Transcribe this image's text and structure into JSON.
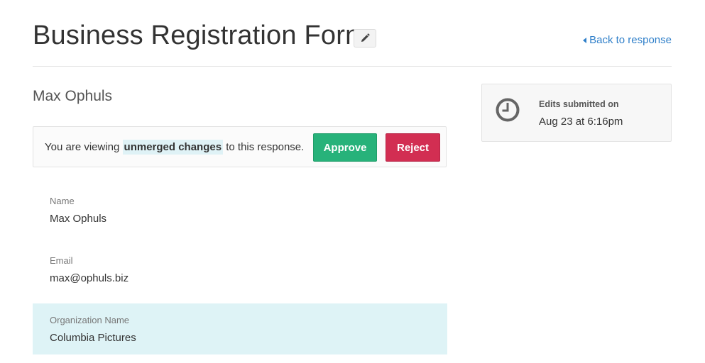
{
  "header": {
    "title": "Business Registration Form",
    "edit_icon": "pencil-icon",
    "back_link": "Back to response",
    "back_icon": "caret-left-icon"
  },
  "respondent": {
    "name": "Max Ophuls"
  },
  "notice": {
    "text_before": "You are viewing ",
    "highlight": "unmerged changes",
    "text_after": " to this response.",
    "approve_label": "Approve",
    "reject_label": "Reject"
  },
  "fields": [
    {
      "label": "Name",
      "value": "Max Ophuls"
    },
    {
      "label": "Email",
      "value": "max@ophuls.biz"
    },
    {
      "label": "Organization Name",
      "value": "Columbia Pictures",
      "changed": true
    }
  ],
  "sidebar": {
    "icon": "clock-icon",
    "title": "Edits submitted on",
    "timestamp": "Aug 23 at 6:16pm"
  },
  "colors": {
    "link": "#2f7fc9",
    "approve": "#27b27a",
    "reject": "#d22e52",
    "highlight": "#def3f6"
  }
}
